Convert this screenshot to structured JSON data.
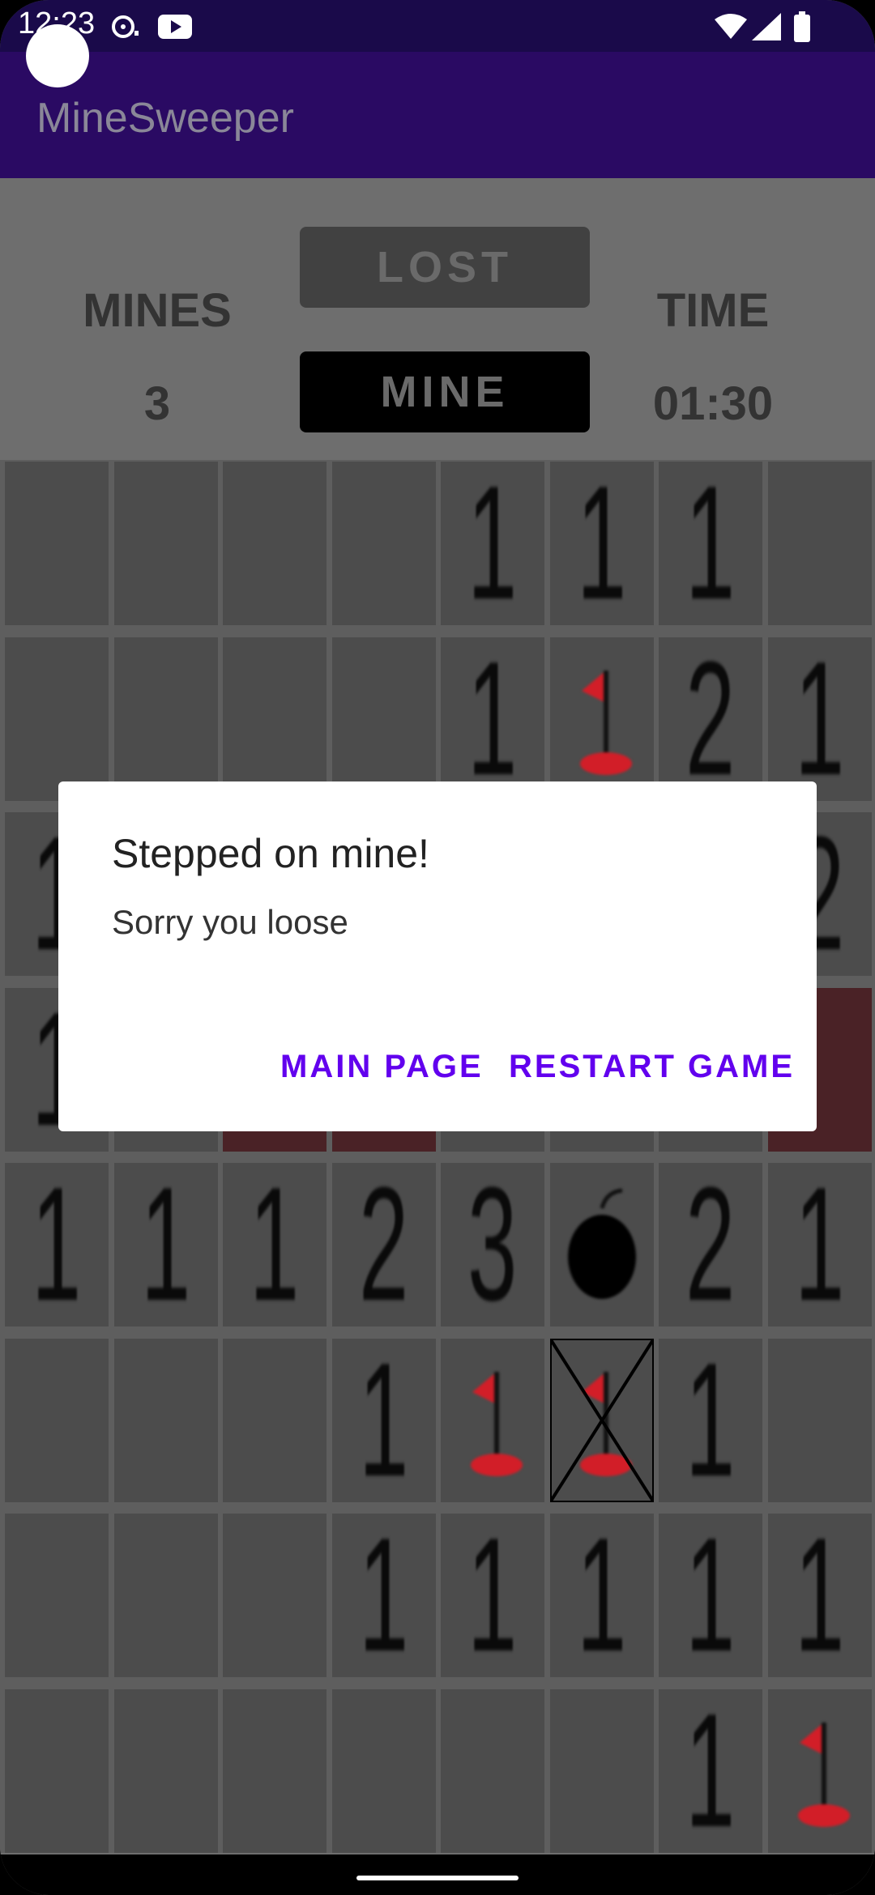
{
  "status_bar": {
    "time": "12:23"
  },
  "app_bar": {
    "title": "MineSweeper"
  },
  "header": {
    "mines_label": "MINES",
    "mines_value": "3",
    "state_button": "LOST",
    "mode_button": "MINE",
    "time_label": "TIME",
    "time_value": "01:30"
  },
  "board": {
    "rows": [
      [
        "",
        "",
        "",
        "",
        "1",
        "1",
        "1",
        ""
      ],
      [
        "",
        "",
        "",
        "",
        "1",
        "flag",
        "2",
        "1"
      ],
      [
        "1",
        "",
        "",
        "",
        "",
        "",
        "",
        "2"
      ],
      [
        "1",
        "",
        "red",
        "red",
        "",
        "",
        "",
        "red"
      ],
      [
        "1",
        "1",
        "1",
        "2",
        "3",
        "bomb",
        "2",
        "1"
      ],
      [
        "",
        "",
        "",
        "1",
        "flag",
        "wrong-flag",
        "1",
        ""
      ],
      [
        "",
        "",
        "",
        "1",
        "1",
        "1",
        "1",
        "1"
      ],
      [
        "",
        "",
        "",
        "",
        "",
        "",
        "1",
        "flag"
      ]
    ]
  },
  "dialog": {
    "title": "Stepped on mine!",
    "message": "Sorry you loose",
    "main_page_button": "MAIN PAGE",
    "restart_button": "RESTART GAME"
  }
}
